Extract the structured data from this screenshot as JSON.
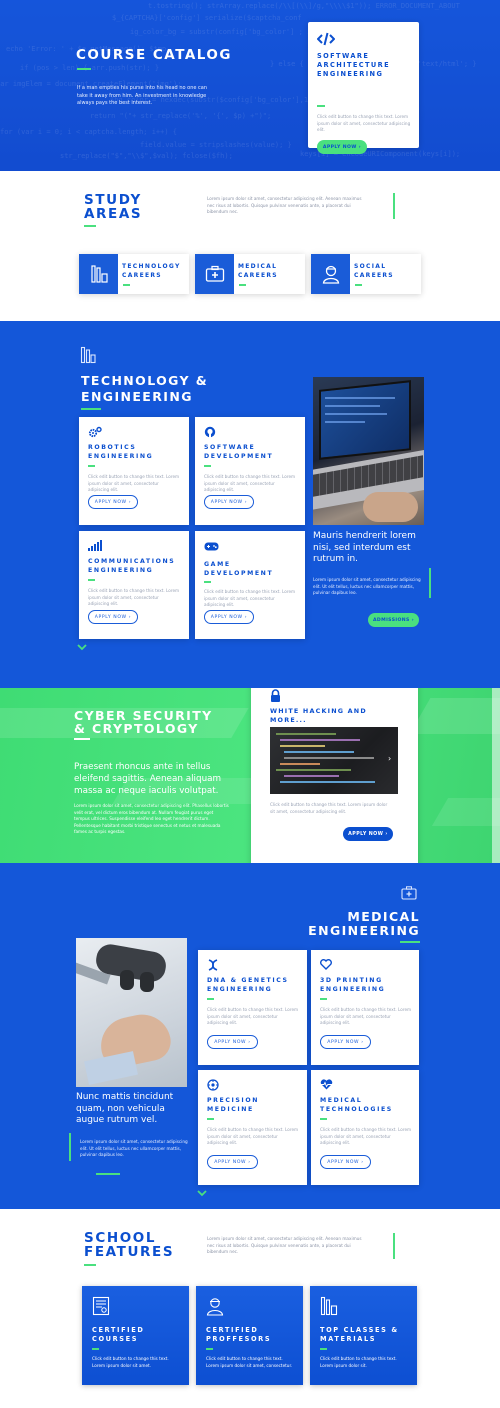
{
  "hero": {
    "title": "COURSE CATALOG",
    "text": "If a man empties his purse into his head no one can take it away from him. An investment in knowledge always pays the best interest.",
    "code_lines": [
      "t.tostring(); strArray.replace(/\\\\[(\\\\]/g,\"\\\\\\\\$1\")); ERROR_DOCUMENT_ABOUT",
      "$_{CAPTCHA}['config']   serialize($captcha_conf",
      "ig_color_bg = substr(config['bg_color'] ; i",
      "echo 'Error: ' + $e.getMessage(); $tmp",
      "  if (pos > len) { arr.push(str); }",
      "var imgElem = document.createElement('img');",
      "  $bg_color = hexdec(substr($config['bg_color'],1,2));",
      "  return \"(\"+ str_replace('%', '{', $p) +\")\";",
      "for (var i = 0; i < captcha.length; i++) {",
      "  field.value = stripslashes(value); }",
      "  str_replace(\"$\",\"\\\\$\",$val);  fclose($fh);",
      "} else { headers['Content-Type'] = 'text/html'; }",
      "  keys[i] = encodeURIComponent(keys[i]);"
    ],
    "card": {
      "icon": "code-icon",
      "title": "SOFTWARE ARCHITECTURE ENGINEERING",
      "text": "Click edit button to change this text. Lorem ipsum dolor sit amet, consectetur adipiscing elit.",
      "button": "APPLY NOW ›"
    }
  },
  "study": {
    "title": "STUDY AREAS",
    "text": "Lorem ipsum dolor sit amet, consectetur adipiscing elit. Aenean maximus nec risus at lobortis. Quisque pulvinar venenatis ante, a placerat dui bibendum nec.",
    "areas": [
      {
        "icon": "tools-icon",
        "label": "TECHNOLOGY CAREERS"
      },
      {
        "icon": "medical-kit-icon",
        "label": "MEDICAL CAREERS"
      },
      {
        "icon": "person-icon",
        "label": "SOCIAL CAREERS"
      }
    ]
  },
  "tech": {
    "title": "TECHNOLOGY & ENGINEERING",
    "cards": [
      {
        "icon": "cogs-icon",
        "title": "ROBOTICS ENGINEERING",
        "text": "Click edit button to change this text. Lorem ipsum dolor sit amet, consectetur adipiscing elit.",
        "button": "APPLY NOW ›"
      },
      {
        "icon": "github-icon",
        "title": "SOFTWARE DEVELOPMENT",
        "text": "Click edit button to change this text. Lorem ipsum dolor sit amet, consectetur adipiscing elit.",
        "button": "APPLY NOW ›"
      },
      {
        "icon": "signal-icon",
        "title": "COMMUNICATIONS ENGINEERING",
        "text": "Click edit button to change this text. Lorem ipsum dolor sit amet, consectetur adipiscing elit.",
        "button": "APPLY NOW ›"
      },
      {
        "icon": "gamepad-icon",
        "title": "GAME DEVELOPMENT",
        "text": "Click edit button to change this text. Lorem ipsum dolor sit amet, consectetur adipiscing elit.",
        "button": "APPLY NOW ›"
      }
    ],
    "quote": "Mauris hendrerit lorem nisi, sed interdum est rutrum in.",
    "text": "Lorem ipsum dolor sit amet, consectetur adipiscing elit. Ut elit tellus, luctus nec ullamcorper mattis, pulvinar dapibus leo.",
    "button": "ADMISSIONS ›"
  },
  "cyber": {
    "title": "CYBER SECURITY & CRYPTOLOGY",
    "subtitle": "Praesent rhoncus ante in tellus eleifend sagittis. Aenean aliquam massa ac neque iaculis volutpat.",
    "text": "Lorem ipsum dolor sit amet, consectetur adipiscing elit. Phasellus lobortis velit erat, vel dictum eros bibendum at. Nullam feugiat purus eget tempus ultrices. Suspendisse eleifend leo eget hendrerit dictum. Pellentesque habitant morbi tristique senectus et netus et malesuada fames ac turpis egestas.",
    "card": {
      "icon": "lock-icon",
      "title": "WHITE HACKING AND MORE...",
      "text": "Click edit button to change this text. Lorem ipsum dolor sit amet, consectetur adipiscing elit.",
      "button": "APPLY NOW ›"
    }
  },
  "medical": {
    "title": "MEDICAL ENGINEERING",
    "quote": "Nunc mattis tincidunt quam, non vehicula augue rutrum vel.",
    "text": "Lorem ipsum dolor sit amet, consectetur adipiscing elit. Ut elit tellus, luctus nec ullamcorper mattis, pulvinar dapibus leo.",
    "cards": [
      {
        "icon": "dna-icon",
        "title": "DNA & GENETICS ENGINEERING",
        "text": "Click edit button to change this text. Lorem ipsum dolor sit amet, consectetur adipiscing elit.",
        "button": "APPLY NOW ›"
      },
      {
        "icon": "heart-icon",
        "title": "3D PRINTING ENGINEERING",
        "text": "Click edit button to change this text. Lorem ipsum dolor sit amet, consectetur adipiscing elit.",
        "button": "APPLY NOW ›"
      },
      {
        "icon": "atom-icon",
        "title": "PRECISION MEDICINE",
        "text": "Click edit button to change this text. Lorem ipsum dolor sit amet, consectetur adipiscing elit.",
        "button": "APPLY NOW ›"
      },
      {
        "icon": "heartbeat-icon",
        "title": "MEDICAL TECHNOLOGIES",
        "text": "Click edit button to change this text. Lorem ipsum dolor sit amet, consectetur adipiscing elit.",
        "button": "APPLY NOW ›"
      }
    ]
  },
  "features": {
    "title": "SCHOOL FEATURES",
    "text": "Lorem ipsum dolor sit amet, consectetur adipiscing elit. Aenean maximus nec risus at lobortis. Quisque pulvinar venenatis ante, a placerat dui bibendum nec.",
    "items": [
      {
        "icon": "certificate-icon",
        "title": "CERTIFIED COURSES",
        "text": "Click edit button to change this text. Lorem ipsum dolor sit amet."
      },
      {
        "icon": "professor-icon",
        "title": "CERTIFIED PROFFESORS",
        "text": "Click edit button to change this text. Lorem ipsum dolor sit amet, consectetur."
      },
      {
        "icon": "materials-icon",
        "title": "TOP CLASSES & MATERIALS",
        "text": "Click edit button to change this text. Lorem ipsum dolor sit."
      }
    ]
  },
  "colors": {
    "blue": "#0b4fcf",
    "green": "#4ae07f"
  }
}
